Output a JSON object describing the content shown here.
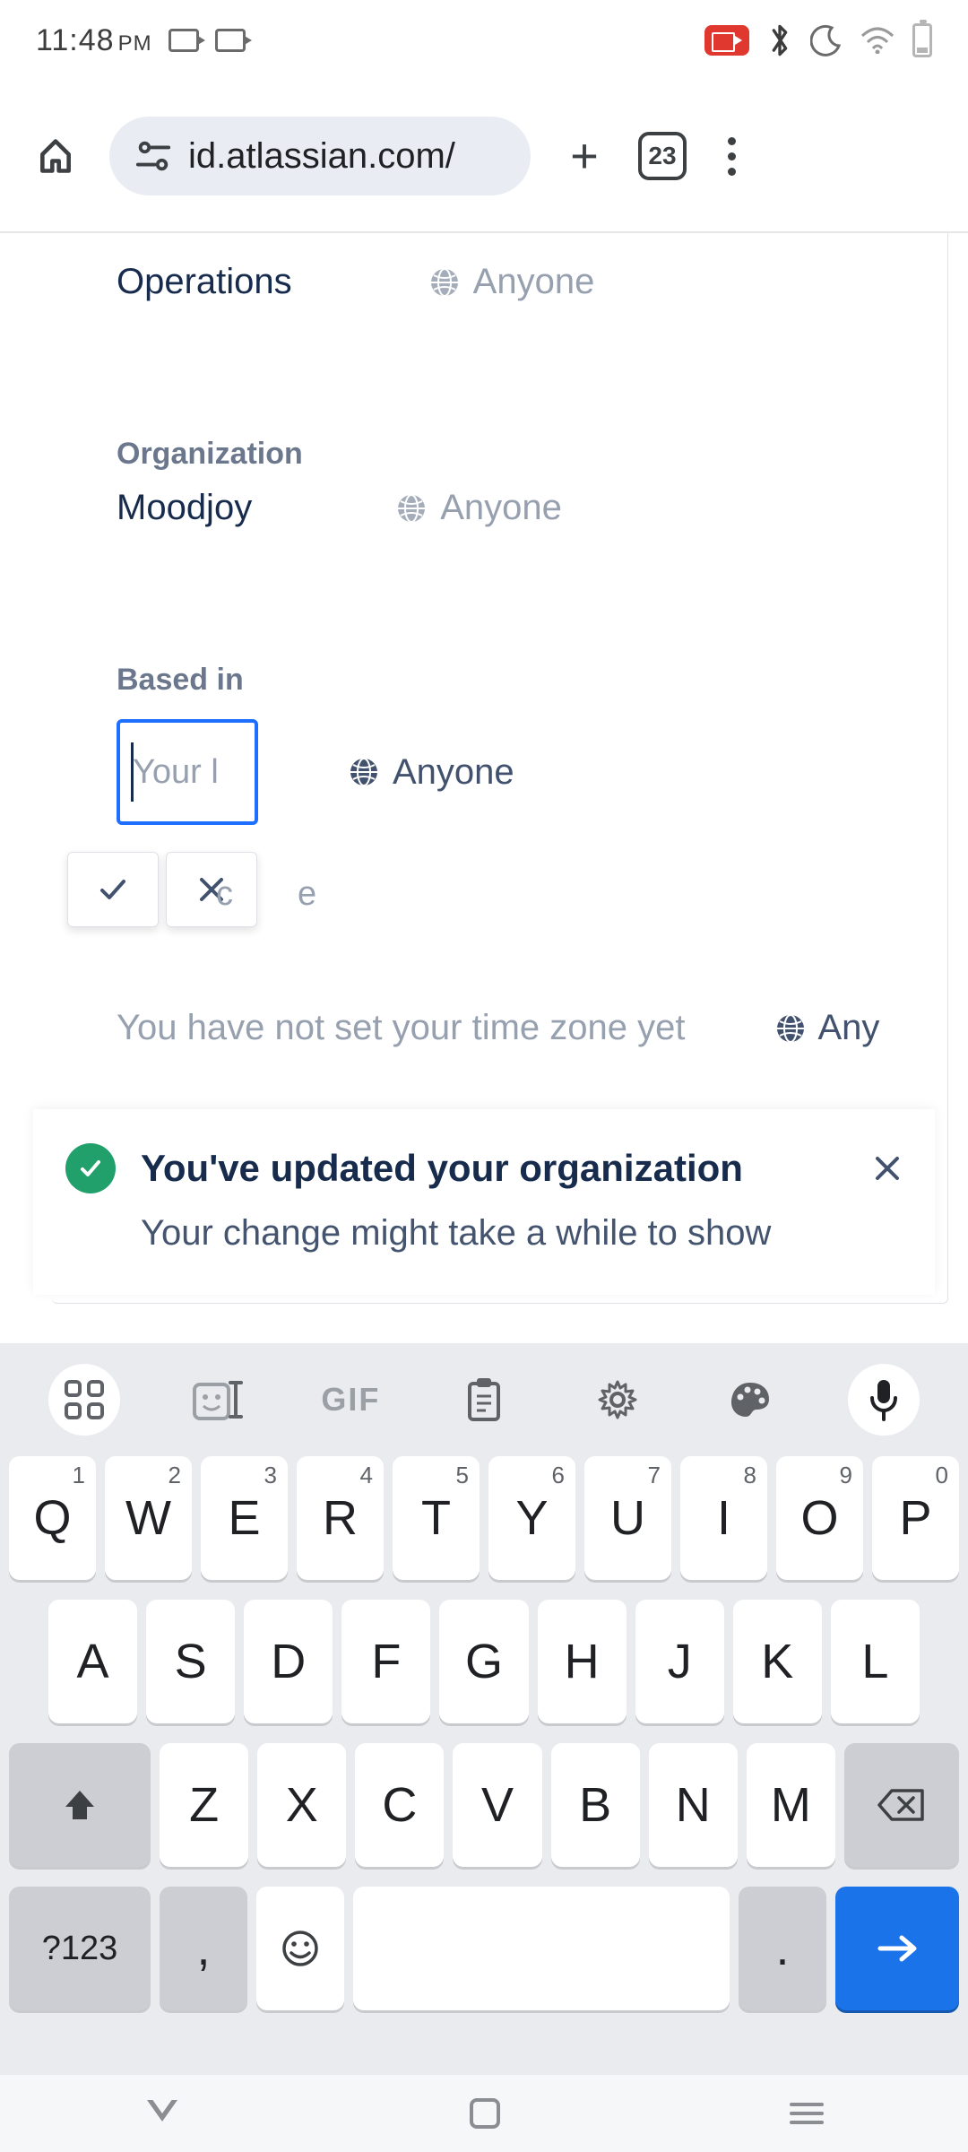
{
  "status": {
    "time": "11:48",
    "ampm": "PM"
  },
  "browser": {
    "url": "id.atlassian.com/",
    "tab_count": "23"
  },
  "profile": {
    "operations_value": "Operations",
    "operations_visibility": "Anyone",
    "org_label": "Organization",
    "org_value": "Moodjoy",
    "org_visibility": "Anyone",
    "basedin_label": "Based in",
    "basedin_placeholder": "Your l",
    "basedin_visibility": "Anyone",
    "ghost": "ce",
    "tz_text": "You have not set your time zone yet",
    "tz_visibility": "Any"
  },
  "toast": {
    "title": "You've updated your organization",
    "subtitle": "Your change might take a while to show"
  },
  "keyboard": {
    "gif": "GIF",
    "row1": [
      {
        "k": "Q",
        "n": "1"
      },
      {
        "k": "W",
        "n": "2"
      },
      {
        "k": "E",
        "n": "3"
      },
      {
        "k": "R",
        "n": "4"
      },
      {
        "k": "T",
        "n": "5"
      },
      {
        "k": "Y",
        "n": "6"
      },
      {
        "k": "U",
        "n": "7"
      },
      {
        "k": "I",
        "n": "8"
      },
      {
        "k": "O",
        "n": "9"
      },
      {
        "k": "P",
        "n": "0"
      }
    ],
    "row2": [
      "A",
      "S",
      "D",
      "F",
      "G",
      "H",
      "J",
      "K",
      "L"
    ],
    "row3": [
      "Z",
      "X",
      "C",
      "V",
      "B",
      "N",
      "M"
    ],
    "sym": "?123",
    "comma": ",",
    "period": "."
  }
}
